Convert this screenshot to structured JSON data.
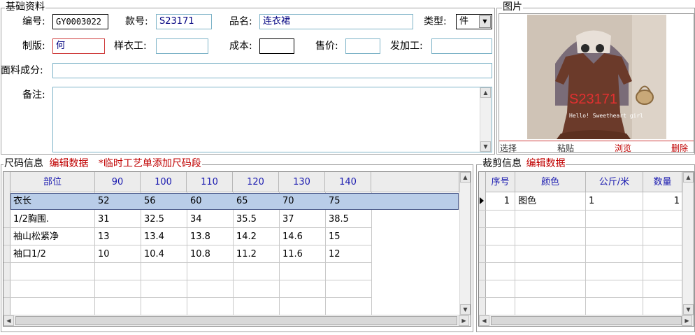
{
  "basic": {
    "legend": "基础资料",
    "code_label": "编号:",
    "code_value": "GY0003022",
    "style_label": "款号:",
    "style_value": "S23171",
    "name_label": "品名:",
    "name_value": "连衣裙",
    "type_label": "类型:",
    "type_value": "件",
    "maker_label": "制版:",
    "maker_value": "何",
    "sample_label": "样衣工:",
    "sample_value": "",
    "cost_label": "成本:",
    "cost_value": "",
    "price_label": "售价:",
    "price_value": "",
    "process_label": "发加工:",
    "process_value": "",
    "fabric_label": "面料成分:",
    "fabric_value": "",
    "remark_label": "备注:",
    "remark_value": ""
  },
  "picture": {
    "legend": "图片",
    "image_text": "S23171",
    "image_subtext": "Hello! Sweetheart girl",
    "actions": [
      "选择",
      "粘贴",
      "浏览",
      "删除"
    ]
  },
  "size": {
    "legend": "尺码信息",
    "edit_link": "编辑数据",
    "temp_link": "*临时工艺单添加尺码段",
    "headers": [
      "部位",
      "90",
      "100",
      "110",
      "120",
      "130",
      "140"
    ],
    "rows": [
      [
        "衣长",
        "52",
        "56",
        "60",
        "65",
        "70",
        "75"
      ],
      [
        "1/2胸围.",
        "31",
        "32.5",
        "34",
        "35.5",
        "37",
        "38.5"
      ],
      [
        "袖山松紧净",
        "13",
        "13.4",
        "13.8",
        "14.2",
        "14.6",
        "15"
      ],
      [
        "袖口1/2",
        "10",
        "10.4",
        "10.8",
        "11.2",
        "11.6",
        "12"
      ]
    ]
  },
  "cut": {
    "legend": "裁剪信息",
    "edit_link": "编辑数据",
    "headers": [
      "序号",
      "颜色",
      "公斤/米",
      "数量"
    ],
    "rows": [
      [
        "1",
        "图色",
        "1",
        "1"
      ]
    ]
  }
}
